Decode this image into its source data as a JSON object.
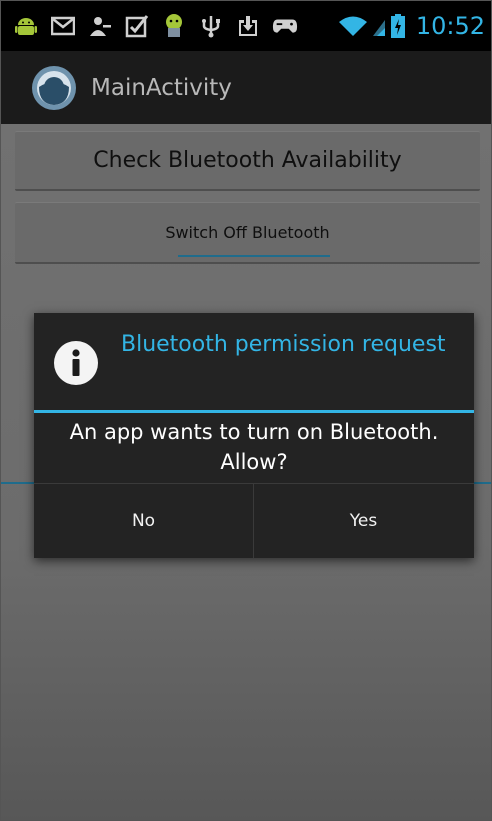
{
  "status_bar": {
    "time": "10:52",
    "icons": [
      "android-icon",
      "gmail-icon",
      "account-icon",
      "clipboard-check-icon",
      "android-app-icon",
      "usb-icon",
      "download-icon",
      "game-controller-icon",
      "wifi-icon",
      "signal-icon",
      "battery-charging-icon"
    ],
    "accent_color": "#33b5e5"
  },
  "action_bar": {
    "title": "MainActivity",
    "icon": "app-icon"
  },
  "main": {
    "check_button_label": "Check Bluetooth Availability",
    "switch_button_label": "Switch Off Bluetooth"
  },
  "dialog": {
    "icon": "info-icon",
    "title": "Bluetooth permission request",
    "message": "An app wants to turn on Bluetooth. Allow?",
    "negative_label": "No",
    "positive_label": "Yes",
    "accent_color": "#33b5e5"
  }
}
